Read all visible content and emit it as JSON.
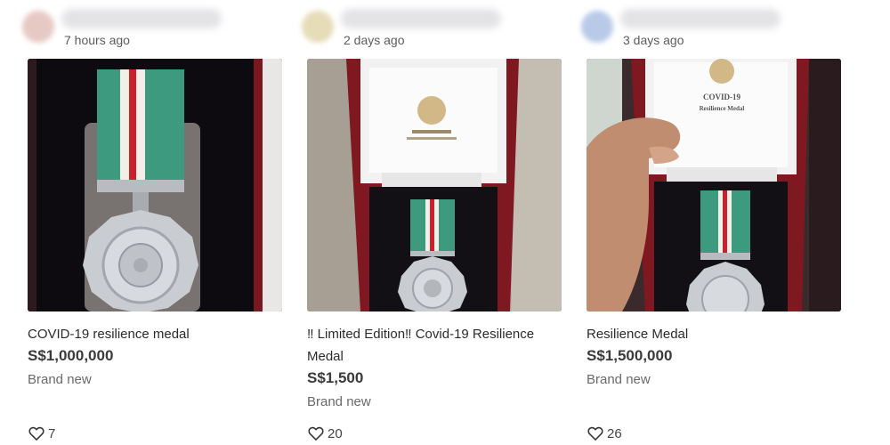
{
  "listings": [
    {
      "time": "7 hours ago",
      "title": "COVID-19 resilience medal",
      "price": "S$1,000,000",
      "condition": "Brand new",
      "likes": "7",
      "avatar_color": "#e7c9c4"
    },
    {
      "time": "2 days ago",
      "title": "‼ Limited Edition‼ Covid-19 Resilience Medal",
      "price": "S$1,500",
      "condition": "Brand new",
      "likes": "20",
      "avatar_color": "#e6dcb8"
    },
    {
      "time": "3 days ago",
      "title": "Resilience Medal",
      "price": "S$1,500,000",
      "condition": "Brand new",
      "likes": "26",
      "avatar_color": "#b9c9e8"
    }
  ],
  "photo_text": {
    "box_lid_title": "COVID-19",
    "box_lid_subtitle": "Resilience Medal"
  },
  "colors": {
    "ribbon_green": "#3d9a7f",
    "ribbon_red": "#c8222c",
    "box_red": "#8a1a22",
    "silver": "#c9ccd0"
  }
}
